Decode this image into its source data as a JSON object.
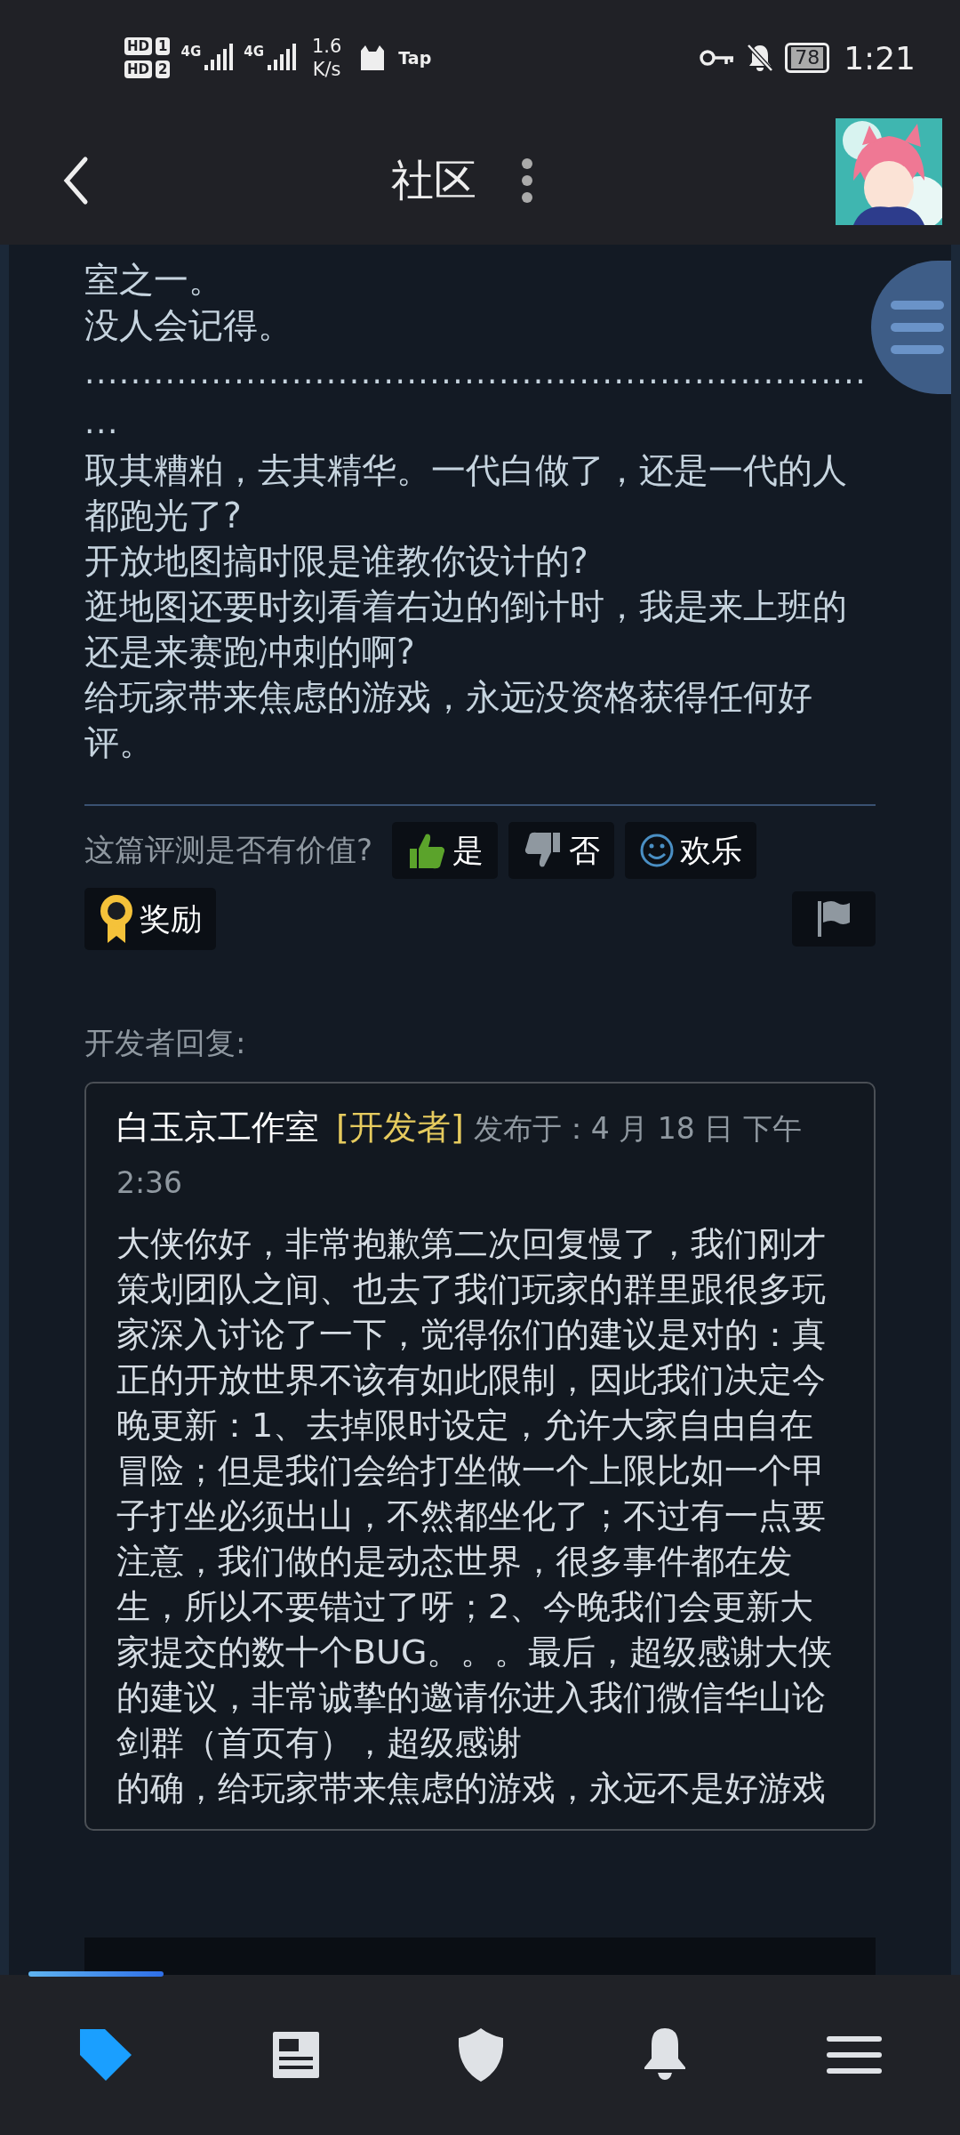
{
  "status_bar": {
    "sim_labels": [
      "HD",
      "HD"
    ],
    "sim_numbers": [
      "1",
      "2"
    ],
    "network": [
      "4G",
      "4G"
    ],
    "speed_value": "1.6",
    "speed_unit": "K/s",
    "app_label": "Tap",
    "battery": "78",
    "time": "1:21"
  },
  "header": {
    "title": "社区"
  },
  "review": {
    "lines": [
      "室之一。",
      "没人会记得。",
      ".......................................................................",
      "取其糟粕，去其精华。一代白做了，还是一代的人都跑光了?",
      "开放地图搞时限是谁教你设计的?",
      "逛地图还要时刻看着右边的倒计时，我是来上班的还是来赛跑冲刺的啊?",
      "给玩家带来焦虑的游戏，永远没资格获得任何好评。"
    ]
  },
  "feedback": {
    "question": "这篇评测是否有价值?",
    "buttons": [
      {
        "kind": "yes",
        "label": "是"
      },
      {
        "kind": "no",
        "label": "否"
      },
      {
        "kind": "funny",
        "label": "欢乐"
      },
      {
        "kind": "award",
        "label": "奖励"
      }
    ]
  },
  "developer_reply": {
    "heading": "开发者回复:",
    "author": "白玉京工作室",
    "badge": "[开发者]",
    "posted": "发布于：4 月 18 日 下午 2:36",
    "body": [
      "大侠你好，非常抱歉第二次回复慢了，我们刚才策划团队之间、也去了我们玩家的群里跟很多玩家深入讨论了一下，觉得你们的建议是对的：真正的开放世界不该有如此限制，因此我们决定今晚更新：1、去掉限时设定，允许大家自由自在冒险；但是我们会给打坐做一个上限比如一个甲子打坐必须出山，不然都坐化了；不过有一点要注意，我们做的是动态世界，很多事件都在发生，所以不要错过了呀；2、今晚我们会更新大家提交的数十个BUG。。。最后，超级感谢大侠的建议，非常诚挚的邀请你进入我们微信华山论剑群（首页有），超级感谢",
      "的确，给玩家带来焦虑的游戏，永远不是好游戏"
    ]
  },
  "bottom_nav": [
    {
      "kind": "tag",
      "selected": true
    },
    {
      "kind": "news",
      "selected": false
    },
    {
      "kind": "shield",
      "selected": false
    },
    {
      "kind": "bell",
      "selected": false
    },
    {
      "kind": "menu",
      "selected": false
    }
  ]
}
